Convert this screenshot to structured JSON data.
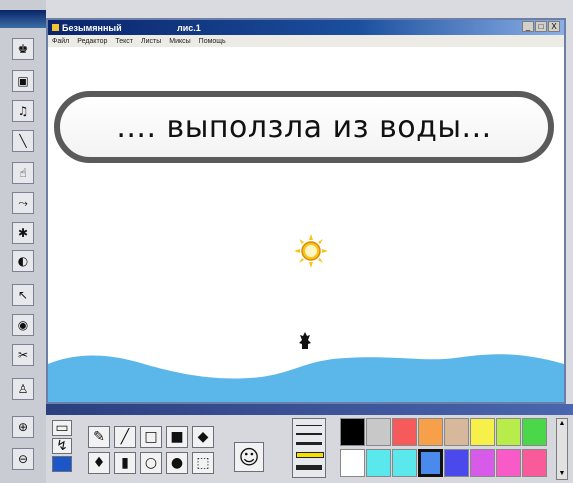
{
  "window": {
    "title": "Безымянный",
    "document": "лис.1",
    "controls": [
      "_",
      "□",
      "X"
    ]
  },
  "menu": [
    "Файл",
    "Редактор",
    "Текст",
    "Листы",
    "Миксы",
    "Помощь"
  ],
  "canvas": {
    "caption": ".... выползла из воды...",
    "sun_color": "#f5c518",
    "water_color": "#5bb6ea"
  },
  "palette": {
    "row1": [
      "#000000",
      "#c8c8c8",
      "#f65a5a",
      "#f6a04a",
      "#d8b89a",
      "#f8f04a",
      "#b8ec4a",
      "#4ad84a"
    ],
    "row2": [
      "#ffffff",
      "#5ae8ec",
      "#5ae8ec",
      "#4a8aec",
      "#4a4aec",
      "#d85ae8",
      "#f85ac8",
      "#f85a9a"
    ]
  },
  "icons": {
    "brush": "✎",
    "line": "╱",
    "rect": "□",
    "filled_rect": "■",
    "eraser": "◆",
    "fill": "♦",
    "stamp": "▮",
    "ellipse": "○",
    "filled_ellipse": "●",
    "select": "⬚",
    "face": "☺"
  }
}
